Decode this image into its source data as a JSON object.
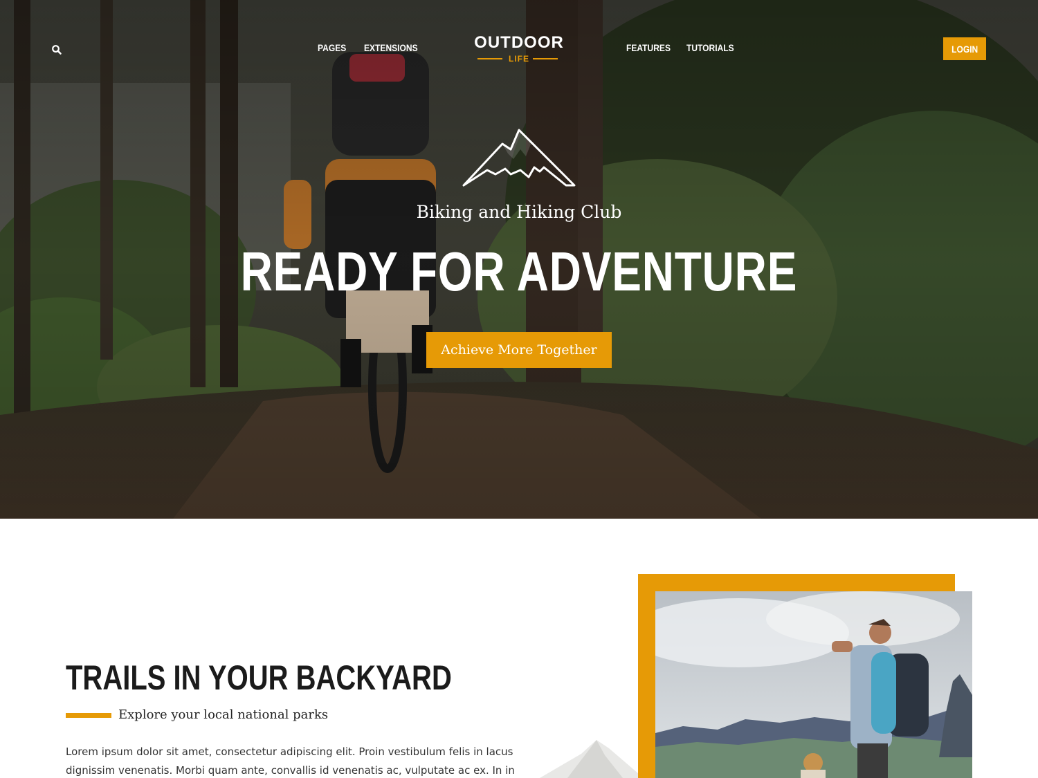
{
  "nav": {
    "search_icon": "search-icon",
    "links_left": [
      "PAGES",
      "EXTENSIONS"
    ],
    "links_right": [
      "FEATURES",
      "TUTORIALS"
    ],
    "login_label": "LOGIN"
  },
  "logo": {
    "main": "OUTDOOR",
    "sub": "LIFE"
  },
  "hero": {
    "icon": "mountain-icon",
    "tagline": "Biking and Hiking Club",
    "title": "READY FOR ADVENTURE",
    "cta_label": "Achieve More Together"
  },
  "section": {
    "title": "TRAILS IN YOUR BACKYARD",
    "subtitle": "Explore your local national parks",
    "body": "Lorem ipsum dolor sit amet, consectetur adipiscing elit. Proin vestibulum felis in lacus dignissim venenatis. Morbi quam ante, convallis id venenatis ac, vulputate ac ex. In in commodo magna."
  },
  "colors": {
    "accent": "#e69a06",
    "text_dark": "#1b1b1b",
    "white": "#ffffff"
  }
}
